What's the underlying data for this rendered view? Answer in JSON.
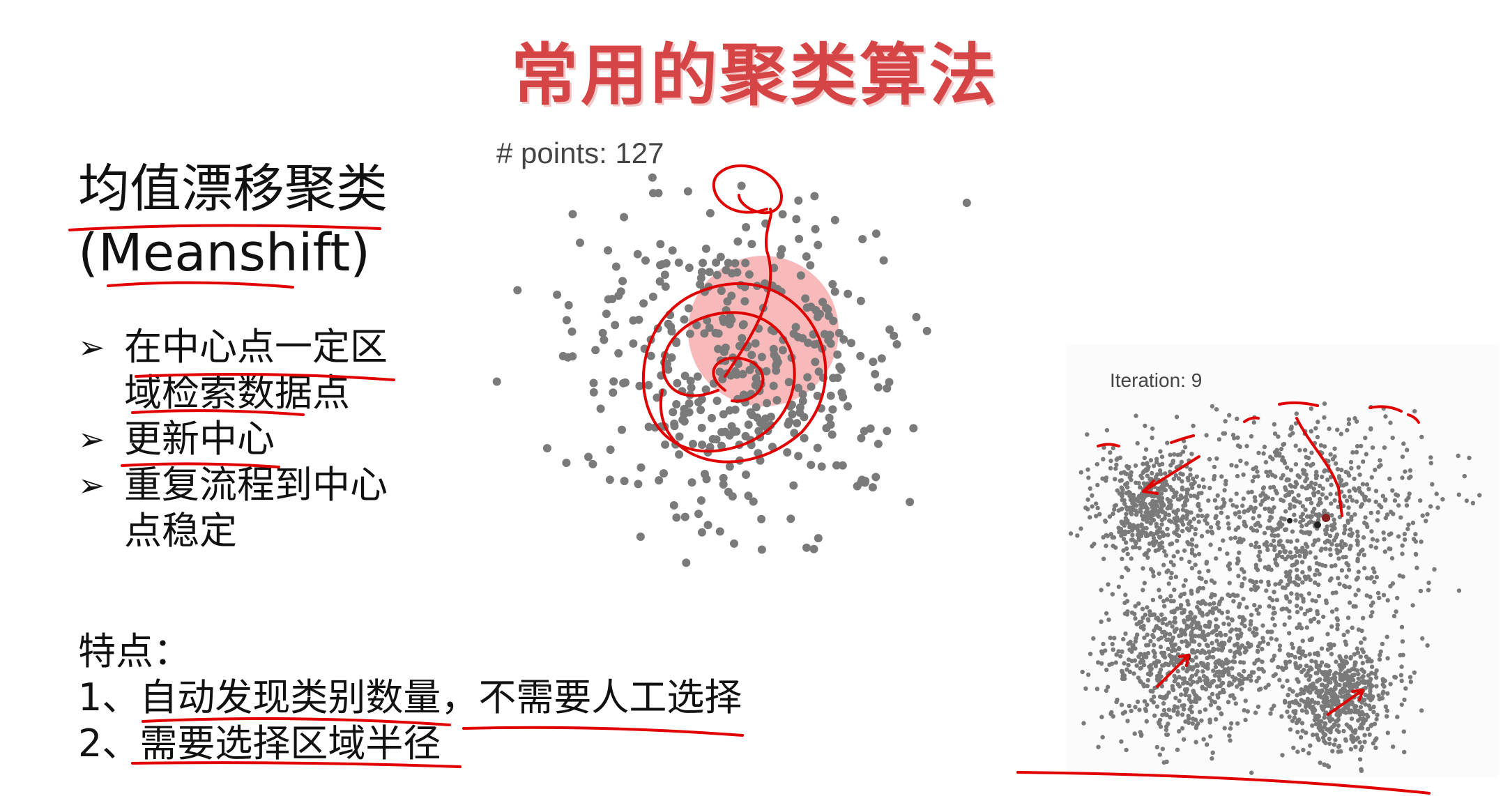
{
  "title": "常用的聚类算法",
  "heading": {
    "line1": "均值漂移聚类",
    "line2": "(Meanshift)"
  },
  "bullets": [
    {
      "line1": "在中心点一定区",
      "line2": "域检索数据点"
    },
    {
      "line1": "更新中心",
      "line2": ""
    },
    {
      "line1": "重复流程到中心",
      "line2": "点稳定"
    }
  ],
  "bullet_marker": "➢",
  "features": {
    "heading": "特点：",
    "items": [
      "1、自动发现类别数量，不需要人工选择",
      "2、需要选择区域半径"
    ]
  },
  "plot_left": {
    "label": "# points: 127"
  },
  "plot_right": {
    "label": "Iteration: 9"
  },
  "colors": {
    "title": "#d64545",
    "points": "#7a7a7a",
    "annotation": "#e00000",
    "window": "#f08080"
  }
}
